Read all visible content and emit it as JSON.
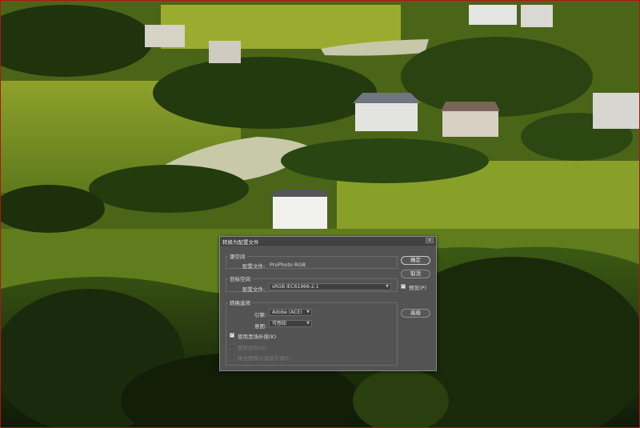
{
  "dialog": {
    "title": "转换为配置文件",
    "close_glyph": "×",
    "source": {
      "legend": "源空间",
      "profile_label": "配置文件:",
      "profile_value": "ProPhoto RGB"
    },
    "destination": {
      "legend": "目标空间",
      "profile_label": "配置文件:",
      "profile_value": "sRGB IEC61966-2.1"
    },
    "options": {
      "legend": "转换选项",
      "engine_label": "引擎:",
      "engine_value": "Adobe (ACE)",
      "intent_label": "意图:",
      "intent_value": "可感知",
      "bpc_label": "使用黑场补偿(K)",
      "bpc_checked": true,
      "dither_label": "使用仿色(D)",
      "dither_checked": false,
      "flatten_label": "拼合图像以保留外观(F)",
      "flatten_checked": false
    },
    "buttons": {
      "ok": "确定",
      "cancel": "取消",
      "preview_label": "预览(P)",
      "preview_checked": true,
      "advanced": "高级"
    }
  },
  "colors": {
    "dialog_bg": "#535353",
    "frame_border": "#b01515"
  }
}
